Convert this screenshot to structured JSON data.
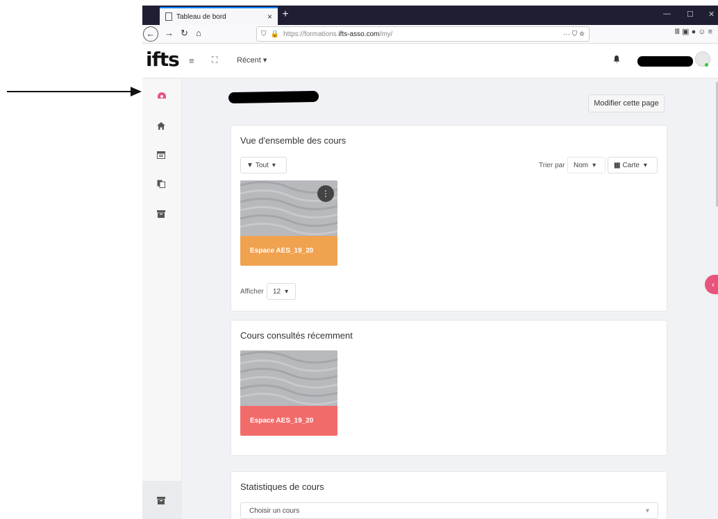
{
  "browser": {
    "tab_title": "Tableau de bord",
    "tab_close": "×",
    "new_tab": "+",
    "window_controls": [
      "—",
      "☐",
      "✕"
    ],
    "url_prefix": "https://formations.",
    "url_host": "ifts-asso.com",
    "url_path": "/my/",
    "url_right_icons": "··· ⛉ ☆",
    "toolbar_right": "Ⅲ  ▣  ●  ☺  ≡"
  },
  "topnav": {
    "logo": "ifts",
    "hamburger": "≡",
    "expand": "⛶",
    "recent_menu": "Récent ▾",
    "bell": "🔔"
  },
  "page": {
    "edit_button": "Modifier cette page"
  },
  "overview": {
    "title": "Vue d'ensemble des cours",
    "filter_button": "Tout",
    "sort_label": "Trier par",
    "sort_value": "Nom",
    "view_value": "Carte",
    "course_name": "Espace AES_19_20",
    "show_label": "Afficher",
    "show_value": "12"
  },
  "recent": {
    "title": "Cours consultés récemment",
    "course_name": "Espace AES_19_20"
  },
  "stats": {
    "title": "Statistiques de cours",
    "select_placeholder": "Choisir un cours"
  },
  "colors": {
    "overview_course": "#f0a24f",
    "recent_course": "#f26b6b",
    "accent": "#e8547c"
  }
}
